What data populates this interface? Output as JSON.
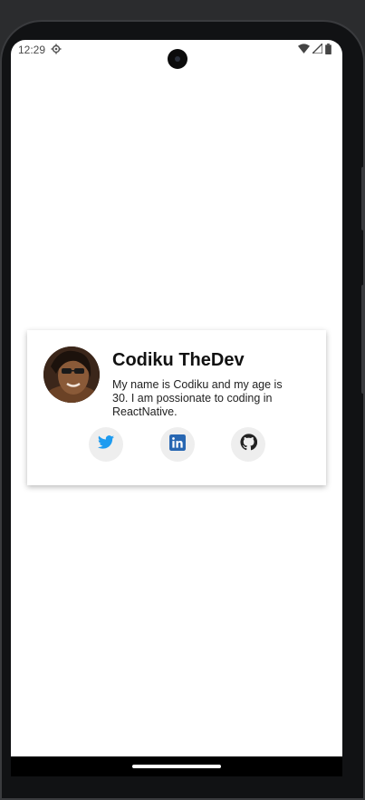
{
  "status_bar": {
    "time": "12:29",
    "icons": [
      "settings-gear-icon",
      "wifi-icon",
      "signal-icon",
      "battery-icon"
    ]
  },
  "profile": {
    "name": "Codiku TheDev",
    "bio": "My name is Codiku and my age is 30. I am possionate to coding in ReactNative.",
    "avatar_icon": "profile-avatar"
  },
  "social_links": [
    {
      "icon": "twitter-icon",
      "color": "#1d9bf0"
    },
    {
      "icon": "linkedin-icon",
      "color": "#2867b2"
    },
    {
      "icon": "github-icon",
      "color": "#222222"
    }
  ]
}
